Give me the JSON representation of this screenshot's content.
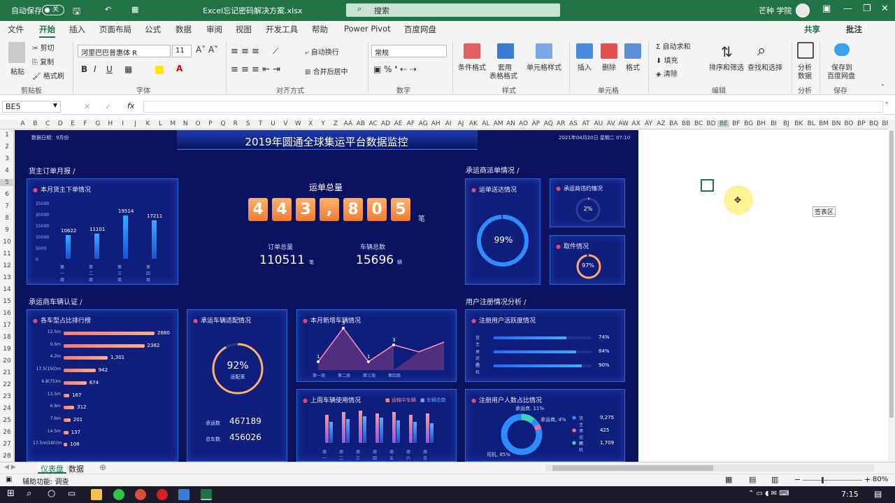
{
  "titlebar": {
    "autosave": "自动保存",
    "toggle": "关",
    "filename": "Excel忘记密码解决方案.xlsx",
    "search": "搜索",
    "user": "芒种 学院"
  },
  "tabs": [
    "文件",
    "开始",
    "插入",
    "页面布局",
    "公式",
    "数据",
    "审阅",
    "视图",
    "开发工具",
    "帮助",
    "Power Pivot",
    "百度网盘"
  ],
  "share": "共享",
  "comment": "批注",
  "ribbon": {
    "paste": "粘贴",
    "cut": "剪切",
    "copy": "复制",
    "painter": "格式刷",
    "font": "河里巴巴普惠体 R",
    "size": "11",
    "wrap": "自动换行",
    "merge": "合并后居中",
    "numfmt": "常规",
    "cond": "条件格式",
    "table1": "套用",
    "table2": "表格格式",
    "cellstyle": "单元格样式",
    "insert": "插入",
    "delete": "删除",
    "format": "格式",
    "autosum": "自动求和",
    "fill": "填充",
    "clear": "清除",
    "sort": "排序和筛选",
    "find": "查找和选择",
    "analyze1": "分析",
    "analyze2": "数据",
    "save1": "保存到",
    "save2": "百度网盘",
    "groups": [
      "剪贴板",
      "字体",
      "对齐方式",
      "数字",
      "样式",
      "单元格",
      "编辑",
      "分析",
      "保存"
    ]
  },
  "formula": {
    "namebox": "BE5",
    "fx": "fx"
  },
  "columns": [
    "A",
    "B",
    "C",
    "D",
    "E",
    "F",
    "G",
    "H",
    "I",
    "J",
    "K",
    "L",
    "M",
    "N",
    "O",
    "P",
    "Q",
    "R",
    "S",
    "T",
    "U",
    "V",
    "W",
    "X",
    "Y",
    "Z",
    "AA",
    "AB",
    "AC",
    "AD",
    "AE",
    "AF",
    "AG",
    "AH",
    "AI",
    "AJ",
    "AK",
    "AL",
    "AM",
    "AN",
    "AO",
    "AP",
    "AQ",
    "AR",
    "AS",
    "AT",
    "AU",
    "AV",
    "AW",
    "AX",
    "AY",
    "AZ",
    "BA",
    "BB",
    "BC",
    "BD",
    "BE",
    "BF",
    "BG",
    "BH",
    "BI",
    "BJ",
    "BK",
    "BL",
    "BM",
    "BN",
    "BO",
    "BP",
    "BQ",
    "BR"
  ],
  "rows": [
    "1",
    "2",
    "3",
    "4",
    "5",
    "6",
    "7",
    "8",
    "9",
    "10",
    "11",
    "12",
    "13",
    "14",
    "15",
    "16",
    "17",
    "18",
    "19",
    "20",
    "21",
    "22",
    "23",
    "24",
    "25",
    "26",
    "27",
    "28"
  ],
  "dashboard": {
    "title": "2019年圆通全球集运平台数据监控",
    "topleft": "数据日期：9月份",
    "topright": "2021年04月20日 星期二 07:10",
    "sec1": "货主订单月报 /",
    "sec2": "承运商车辆认证 /",
    "sec3": "承运商派单情况 /",
    "sec4": "用户注册情况分析 /",
    "p1": "本月货主下单情况",
    "p1_ticks": [
      "25000",
      "20000",
      "15000",
      "10000",
      "5000",
      "0"
    ],
    "p1_labels": [
      "第一周",
      "第二周",
      "第三周",
      "第四周"
    ],
    "p1_values": [
      "10622",
      "11101",
      "19514",
      "17211"
    ],
    "total_label": "运单总量",
    "digits": [
      "4",
      "4",
      "3",
      ",",
      "8",
      "0",
      "5"
    ],
    "unit_bi": "笔",
    "orders_label": "订单总量",
    "orders": "110511",
    "orders_unit": "笔",
    "cars_label": "车辆总数",
    "cars": "15696",
    "cars_unit": "辆",
    "p_delivery": "运单送达情况",
    "delivery_pct": "99%",
    "p_cancel": "承运商违约情况",
    "cancel_pct": "2%",
    "p_take": "取件情况",
    "take_pct": "97%",
    "p_rank": "各车型占比排行榜",
    "rank": [
      {
        "label": "12.5m",
        "value": "2680"
      },
      {
        "label": "9.6m",
        "value": "2382"
      },
      {
        "label": "4.2m",
        "value": "1,301"
      },
      {
        "label": "17.5(150)m",
        "value": "942"
      },
      {
        "label": "6.8(75)m",
        "value": "674"
      },
      {
        "label": "13.5m",
        "value": "167"
      },
      {
        "label": "6.8m",
        "value": "312"
      },
      {
        "label": "7.6m",
        "value": "201"
      },
      {
        "label": "14.5m",
        "value": "137"
      },
      {
        "label": "17.5m(180)m",
        "value": "108"
      }
    ],
    "p_match": "承运车辆适配情况",
    "match_pct": "92%",
    "match_sub": "适配率",
    "match_a_label": "承运数",
    "match_a": "467189",
    "match_b_label": "总车数",
    "match_b": "456026",
    "p_new": "本月新增车辆情况",
    "new_points": [
      "1",
      "5",
      "1",
      "3"
    ],
    "new_labels": [
      "第一周",
      "第二周",
      "第三周",
      "第四周"
    ],
    "p_usage": "上周车辆使用情况",
    "usage_leg1": "运输中车辆",
    "usage_leg2": "车辆总数",
    "usage_days": [
      "周一",
      "周二",
      "周三",
      "周四",
      "周五",
      "周六",
      "周日"
    ],
    "p_active": "注册用户活跃度情况",
    "active": [
      {
        "label": "货主",
        "value": "74%"
      },
      {
        "label": "承运商",
        "value": "84%"
      },
      {
        "label": "司机",
        "value": "90%"
      }
    ],
    "p_share": "注册用户人数占比情况",
    "share_top": "承运商, 11%",
    "share_mid": "承运商, 4%",
    "share_bot": "司机, 85%",
    "share_legend": [
      {
        "label": "货主",
        "value": "9,275"
      },
      {
        "label": "承运商",
        "value": "425"
      },
      {
        "label": "司机",
        "value": "1,709"
      }
    ]
  },
  "floating_label": "签表区",
  "sheets": [
    "仪表盘",
    "数据"
  ],
  "status": {
    "accessibility": "辅助功能: 调查",
    "zoom": "80%"
  },
  "time": "7:15"
}
